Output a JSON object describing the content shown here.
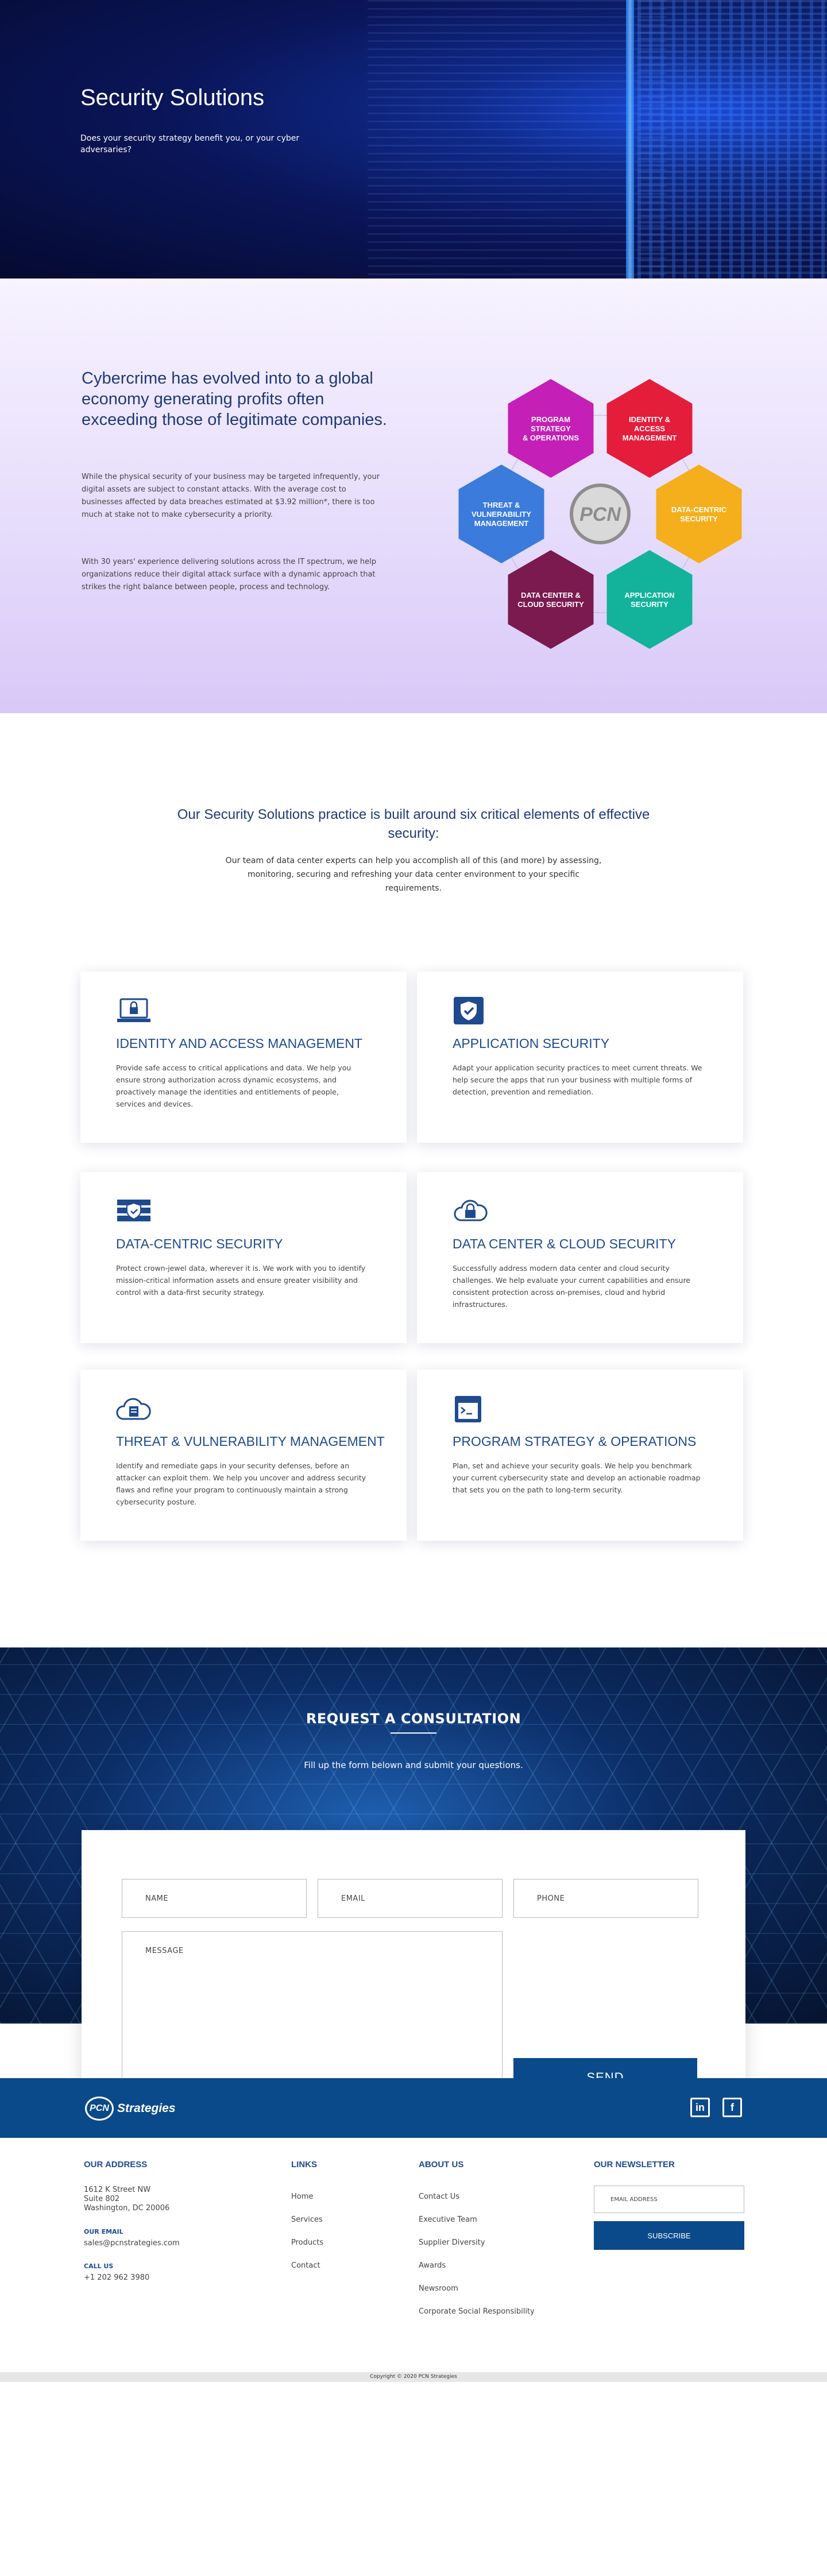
{
  "hero": {
    "title": "Security Solutions",
    "subtitle": "Does your security strategy benefit you, or your cyber adversaries?"
  },
  "intro": {
    "heading": "Cybercrime has evolved into to a global economy generating profits often exceeding those of legitimate companies.",
    "para1": "While the physical security of your business may be targeted infrequently, your digital assets are subject to constant attacks. With the average cost to businesses affected by data breaches estimated at $3.92 million*, there is too much at stake not to make cybersecurity a priority.",
    "para2": "With 30 years' experience delivering solutions across the IT spectrum, we help organizations reduce their digital attack surface with a dynamic approach that strikes the right balance between people, process and technology.",
    "hex": {
      "center": "PCN",
      "items": [
        {
          "label": [
            "PROGRAM",
            "STRATEGY",
            "& OPERATIONS"
          ],
          "color": "#c41fb6"
        },
        {
          "label": [
            "IDENTITY &",
            "ACCESS",
            "MANAGEMENT"
          ],
          "color": "#e41d3b"
        },
        {
          "label": [
            "DATA-CENTRIC",
            "SECURITY"
          ],
          "color": "#f5ae1c"
        },
        {
          "label": [
            "APPLICATION",
            "SECURITY"
          ],
          "color": "#12b39a"
        },
        {
          "label": [
            "DATA CENTER &",
            "CLOUD SECURITY"
          ],
          "color": "#7a1a4f"
        },
        {
          "label": [
            "THREAT &",
            "VULNERABILITY",
            "MANAGEMENT"
          ],
          "color": "#3a7bdc"
        }
      ]
    }
  },
  "practice": {
    "heading": "Our Security Solutions practice is built around six critical elements of effective security:",
    "text": "Our team of data center experts can help you accomplish all of this (and more) by assessing, monitoring, securing and refreshing your data center environment to your specific requirements."
  },
  "cards": [
    {
      "icon": "laptop-lock-icon",
      "title": "IDENTITY AND ACCESS MANAGEMENT",
      "text": "Provide safe access to critical applications and data. We help you ensure strong authorization across dynamic ecosystems, and proactively manage the identities and entitlements of people, services and devices."
    },
    {
      "icon": "shield-check-icon",
      "title": "APPLICATION SECURITY",
      "text": "Adapt your application security practices to meet current threats. We help secure the apps that run your business with multiple forms of detection, prevention and remediation."
    },
    {
      "icon": "server-shield-icon",
      "title": "DATA-CENTRIC SECURITY",
      "text": "Protect crown-jewel data, wherever it is. We work with you to identify mission-critical information assets and ensure greater visibility and control with a data-first security strategy."
    },
    {
      "icon": "cloud-lock-icon",
      "title": "DATA CENTER & CLOUD SECURITY",
      "text": "Successfully address modern data center and cloud security challenges. We help evaluate your current capabilities and ensure consistent protection across on-premises, cloud and hybrid infrastructures."
    },
    {
      "icon": "cloud-server-icon",
      "title": "THREAT & VULNERABILITY MANAGEMENT",
      "text": "Identify and remediate gaps in your security defenses, before an attacker can exploit them. We help you uncover and address security flaws and refine your program to continuously maintain a strong cybersecurity posture."
    },
    {
      "icon": "browser-terminal-icon",
      "title": "PROGRAM STRATEGY & OPERATIONS",
      "text": "Plan, set and achieve your security goals. We help you benchmark your current cybersecurity state and develop an actionable roadmap that sets you on the path to long-term security."
    }
  ],
  "consult": {
    "title": "REQUEST A CONSULTATION",
    "subtitle": "Fill up the form belown and submit your questions.",
    "name_placeholder": "NAME",
    "email_placeholder": "EMAIL",
    "phone_placeholder": "PHONE",
    "message_placeholder": "MESSAGE",
    "send_label": "SEND"
  },
  "brand": {
    "mark": "PCN",
    "name": "Strategies",
    "primary": "#0b4a8a"
  },
  "social": {
    "linkedin": "in",
    "facebook": "f"
  },
  "footer": {
    "address": {
      "heading": "OUR ADDRESS",
      "line1": "1612 K Street NW",
      "line2": "Suite 802",
      "line3": "Washington, DC 20006",
      "email_label": "OUR EMAIL",
      "email": "sales@pcnstrategies.com",
      "call_label": "CALL US",
      "phone": "+1 202 962 3980"
    },
    "links": {
      "heading": "LINKS",
      "items": [
        "Home",
        "Services",
        "Products",
        "Contact"
      ]
    },
    "about": {
      "heading": "ABOUT US",
      "items": [
        "Contact Us",
        "Executive Team",
        "Supplier Diversity",
        "Awards",
        "Newsroom",
        "Corporate Social Responsibility"
      ]
    },
    "newsletter": {
      "heading": "OUR NEWSLETTER",
      "placeholder": "EMAIL ADDRESS",
      "button": "SUBSCRIBE"
    },
    "copyright": "Copyright © 2020 PCN Strategies"
  }
}
